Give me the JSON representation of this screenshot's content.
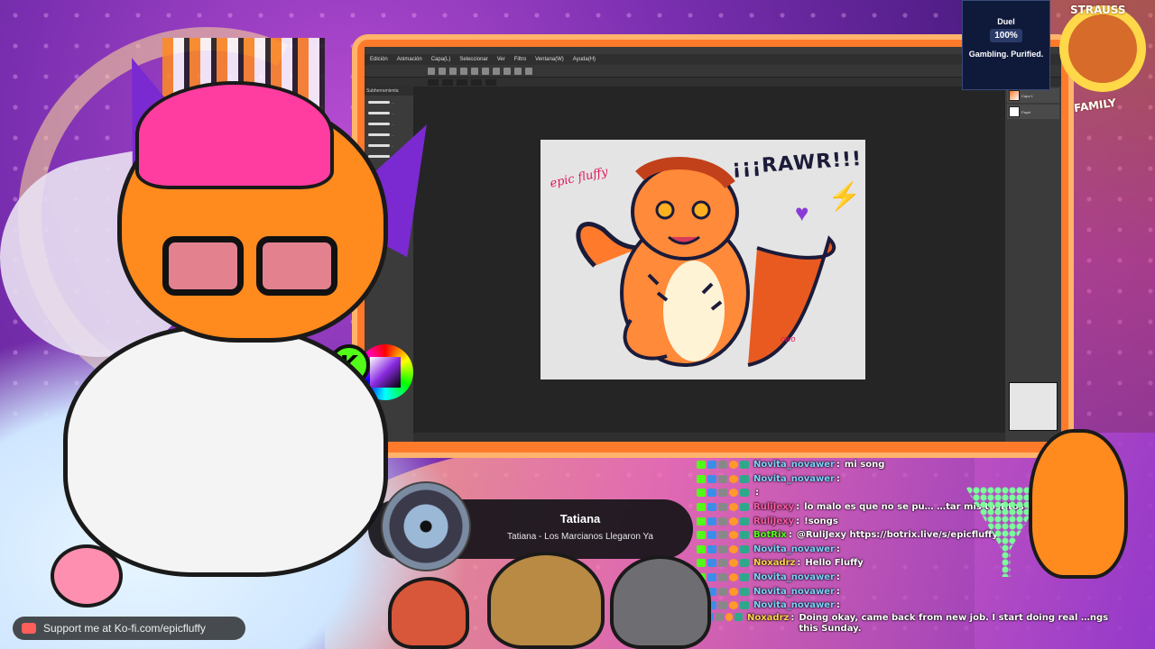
{
  "app": {
    "menu": [
      "Edición",
      "Animación",
      "Capa(L)",
      "Seleccionar",
      "Ver",
      "Filtro",
      "Ventana(W)",
      "Ayuda(H)"
    ],
    "layers": [
      "Capa 1",
      "Papel"
    ],
    "brush_panel_title": "Subherramienta",
    "brushes": [
      "...",
      "...",
      "...",
      "...",
      "...",
      "..."
    ]
  },
  "artwork": {
    "headline": "¡¡¡RAWR!!!",
    "signature": "epic fluffy",
    "owo": "owo"
  },
  "overlay": {
    "kick_letter": "K",
    "sponsor": {
      "brand": "Duel",
      "badge": "100%",
      "tagline": "Gambling. Purified."
    },
    "logo_top": "STRAUSS",
    "logo_bottom": "FAMILY",
    "support_text": "Support me at Ko-fi.com/epicfluffy"
  },
  "music": {
    "track": "Tatiana",
    "artist": "Tatiana - Los Marcianos Llegaron Ya"
  },
  "chat": [
    {
      "user": "Novita_novawer",
      "text": "mi song",
      "color": "#7dd3ff"
    },
    {
      "user": "Novita_novawer",
      "text": "",
      "color": "#7dd3ff"
    },
    {
      "user": "",
      "text": "",
      "color": "#ffffff"
    },
    {
      "user": "RuliJexy",
      "text": "lo malo es que no se pu… …tar mis tostitos desde esa pagina",
      "color": "#ff5aa5"
    },
    {
      "user": "RuliJexy",
      "text": "!songs",
      "color": "#ff5aa5"
    },
    {
      "user": "BotRix",
      "text": "@RuliJexy https://botrix.live/s/epicfluffy",
      "color": "#53fc18"
    },
    {
      "user": "Novita_novawer",
      "text": "",
      "color": "#7dd3ff"
    },
    {
      "user": "Noxadrz",
      "text": "Hello Fluffy",
      "color": "#ffd24a"
    },
    {
      "user": "Novita_novawer",
      "text": "",
      "color": "#7dd3ff"
    },
    {
      "user": "Novita_novawer",
      "text": "",
      "color": "#7dd3ff"
    },
    {
      "user": "Novita_novawer",
      "text": "",
      "color": "#7dd3ff"
    },
    {
      "user": "Noxadrz",
      "text": "Doing okay, came back from new job. I start doing real …ngs this Sunday.",
      "color": "#ffd24a"
    }
  ]
}
